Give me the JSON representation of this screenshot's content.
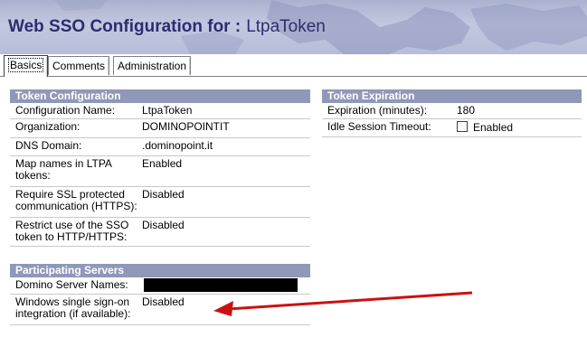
{
  "header": {
    "title_prefix": "Web SSO Configuration for :",
    "title_doc": "LtpaToken"
  },
  "tabs": [
    {
      "label": "Basics",
      "active": true
    },
    {
      "label": "Comments",
      "active": false
    },
    {
      "label": "Administration",
      "active": false
    }
  ],
  "token_configuration": {
    "heading": "Token Configuration",
    "rows": [
      {
        "label": "Configuration Name:",
        "value": "LtpaToken"
      },
      {
        "label": "Organization:",
        "value": "DOMINOPOINTIT"
      },
      {
        "label": "DNS Domain:",
        "value": ".dominopoint.it"
      },
      {
        "label_lines": [
          "Map names in LTPA",
          "tokens:"
        ],
        "value": "Enabled"
      },
      {
        "label_lines": [
          "Require SSL protected",
          "communication (HTTPS):"
        ],
        "value": "Disabled"
      },
      {
        "label_lines": [
          "Restrict use of the SSO",
          "token to HTTP/HTTPS:"
        ],
        "value": "Disabled"
      }
    ]
  },
  "token_expiration": {
    "heading": "Token Expiration",
    "rows": [
      {
        "label": "Expiration (minutes):",
        "value": "180"
      },
      {
        "label": "Idle Session Timeout:",
        "value": "Enabled",
        "checked": false
      }
    ]
  },
  "participating_servers": {
    "heading": "Participating Servers",
    "rows": [
      {
        "label": "Domino Server Names:",
        "value": ""
      },
      {
        "label_lines": [
          "Windows single sign-on",
          "integration (if available):"
        ],
        "value": "Disabled"
      }
    ]
  },
  "colors": {
    "section_header": "#9098b8",
    "title_text": "#2b2e6e",
    "arrow": "#cc1111"
  },
  "icons": [
    "world-map-graphic",
    "red-arrow-annotation"
  ]
}
